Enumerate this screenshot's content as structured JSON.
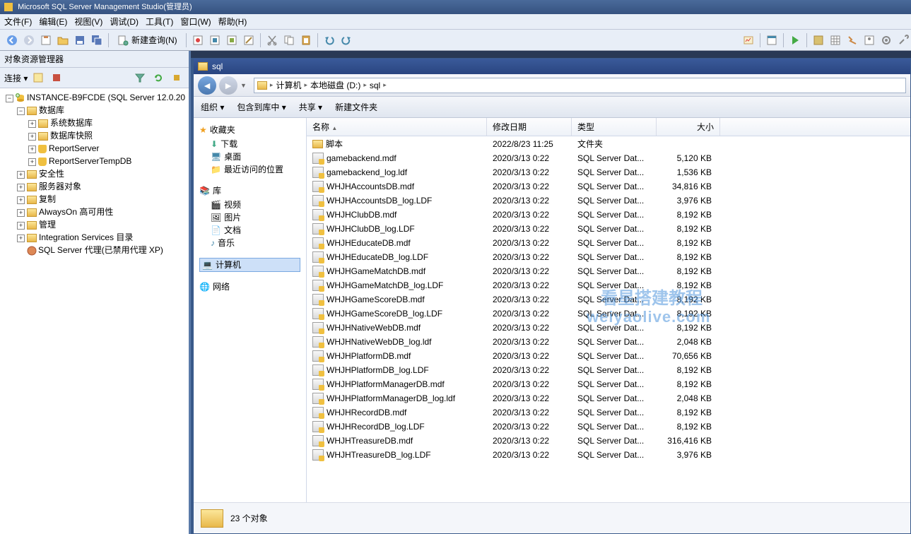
{
  "app": {
    "title": "Microsoft SQL Server Management Studio(管理员)"
  },
  "menus": [
    "文件(F)",
    "编辑(E)",
    "视图(V)",
    "调试(D)",
    "工具(T)",
    "窗口(W)",
    "帮助(H)"
  ],
  "toolbar": {
    "new_query": "新建查询(N)"
  },
  "sidebar": {
    "title": "对象资源管理器",
    "connect_label": "连接 ▾",
    "server": "INSTANCE-B9FCDE (SQL Server 12.0.20",
    "nodes": {
      "databases": "数据库",
      "sys_db": "系统数据库",
      "db_snap": "数据库快照",
      "rpt": "ReportServer",
      "rpt_tmp": "ReportServerTempDB",
      "security": "安全性",
      "server_obj": "服务器对象",
      "replication": "复制",
      "alwayson": "AlwaysOn 高可用性",
      "management": "管理",
      "integration": "Integration Services 目录",
      "agent": "SQL Server 代理(已禁用代理 XP)"
    }
  },
  "explorer": {
    "title": "sql",
    "breadcrumb": [
      "计算机",
      "本地磁盘 (D:)",
      "sql"
    ],
    "cmd": {
      "org": "组织 ▾",
      "include": "包含到库中 ▾",
      "share": "共享 ▾",
      "new": "新建文件夹"
    },
    "nav": {
      "favorites": "收藏夹",
      "download": "下载",
      "desktop": "桌面",
      "recent": "最近访问的位置",
      "library": "库",
      "video": "视频",
      "picture": "图片",
      "doc": "文档",
      "music": "音乐",
      "computer": "计算机",
      "network": "网络"
    },
    "cols": {
      "name": "名称",
      "date": "修改日期",
      "type": "类型",
      "size": "大小"
    },
    "files": [
      {
        "name": "脚本",
        "date": "2022/8/23 11:25",
        "type": "文件夹",
        "size": "",
        "kind": "folder"
      },
      {
        "name": "gamebackend.mdf",
        "date": "2020/3/13 0:22",
        "type": "SQL Server Dat...",
        "size": "5,120 KB",
        "kind": "db"
      },
      {
        "name": "gamebackend_log.ldf",
        "date": "2020/3/13 0:22",
        "type": "SQL Server Dat...",
        "size": "1,536 KB",
        "kind": "db"
      },
      {
        "name": "WHJHAccountsDB.mdf",
        "date": "2020/3/13 0:22",
        "type": "SQL Server Dat...",
        "size": "34,816 KB",
        "kind": "db"
      },
      {
        "name": "WHJHAccountsDB_log.LDF",
        "date": "2020/3/13 0:22",
        "type": "SQL Server Dat...",
        "size": "3,976 KB",
        "kind": "db"
      },
      {
        "name": "WHJHClubDB.mdf",
        "date": "2020/3/13 0:22",
        "type": "SQL Server Dat...",
        "size": "8,192 KB",
        "kind": "db"
      },
      {
        "name": "WHJHClubDB_log.LDF",
        "date": "2020/3/13 0:22",
        "type": "SQL Server Dat...",
        "size": "8,192 KB",
        "kind": "db"
      },
      {
        "name": "WHJHEducateDB.mdf",
        "date": "2020/3/13 0:22",
        "type": "SQL Server Dat...",
        "size": "8,192 KB",
        "kind": "db"
      },
      {
        "name": "WHJHEducateDB_log.LDF",
        "date": "2020/3/13 0:22",
        "type": "SQL Server Dat...",
        "size": "8,192 KB",
        "kind": "db"
      },
      {
        "name": "WHJHGameMatchDB.mdf",
        "date": "2020/3/13 0:22",
        "type": "SQL Server Dat...",
        "size": "8,192 KB",
        "kind": "db"
      },
      {
        "name": "WHJHGameMatchDB_log.LDF",
        "date": "2020/3/13 0:22",
        "type": "SQL Server Dat...",
        "size": "8,192 KB",
        "kind": "db"
      },
      {
        "name": "WHJHGameScoreDB.mdf",
        "date": "2020/3/13 0:22",
        "type": "SQL Server Dat...",
        "size": "8,192 KB",
        "kind": "db"
      },
      {
        "name": "WHJHGameScoreDB_log.LDF",
        "date": "2020/3/13 0:22",
        "type": "SQL Server Dat...",
        "size": "8,192 KB",
        "kind": "db"
      },
      {
        "name": "WHJHNativeWebDB.mdf",
        "date": "2020/3/13 0:22",
        "type": "SQL Server Dat...",
        "size": "8,192 KB",
        "kind": "db"
      },
      {
        "name": "WHJHNativeWebDB_log.ldf",
        "date": "2020/3/13 0:22",
        "type": "SQL Server Dat...",
        "size": "2,048 KB",
        "kind": "db"
      },
      {
        "name": "WHJHPlatformDB.mdf",
        "date": "2020/3/13 0:22",
        "type": "SQL Server Dat...",
        "size": "70,656 KB",
        "kind": "db"
      },
      {
        "name": "WHJHPlatformDB_log.LDF",
        "date": "2020/3/13 0:22",
        "type": "SQL Server Dat...",
        "size": "8,192 KB",
        "kind": "db"
      },
      {
        "name": "WHJHPlatformManagerDB.mdf",
        "date": "2020/3/13 0:22",
        "type": "SQL Server Dat...",
        "size": "8,192 KB",
        "kind": "db"
      },
      {
        "name": "WHJHPlatformManagerDB_log.ldf",
        "date": "2020/3/13 0:22",
        "type": "SQL Server Dat...",
        "size": "2,048 KB",
        "kind": "db"
      },
      {
        "name": "WHJHRecordDB.mdf",
        "date": "2020/3/13 0:22",
        "type": "SQL Server Dat...",
        "size": "8,192 KB",
        "kind": "db"
      },
      {
        "name": "WHJHRecordDB_log.LDF",
        "date": "2020/3/13 0:22",
        "type": "SQL Server Dat...",
        "size": "8,192 KB",
        "kind": "db"
      },
      {
        "name": "WHJHTreasureDB.mdf",
        "date": "2020/3/13 0:22",
        "type": "SQL Server Dat...",
        "size": "316,416 KB",
        "kind": "db"
      },
      {
        "name": "WHJHTreasureDB_log.LDF",
        "date": "2020/3/13 0:22",
        "type": "SQL Server Dat...",
        "size": "3,976 KB",
        "kind": "db"
      }
    ],
    "status": "23 个对象"
  },
  "watermark": {
    "l1": "看星搭建教程",
    "l2": "weiyaolive.com"
  }
}
